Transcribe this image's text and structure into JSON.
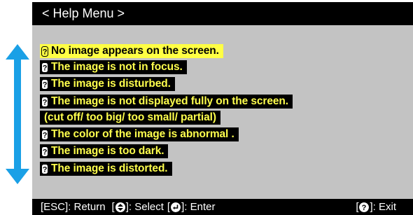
{
  "title": "< Help Menu >",
  "accent_color": "#1aa0e6",
  "items": [
    {
      "label": "No image appears on the screen.",
      "selected": true
    },
    {
      "label": "The image is not in focus.",
      "selected": false
    },
    {
      "label": "The image is disturbed.",
      "selected": false
    },
    {
      "label": "The image is not displayed fully on the screen.",
      "selected": false
    },
    {
      "label": "(cut off/ too big/ too small/ partial)",
      "continuation": true
    },
    {
      "label": "The color of the image is abnormal .",
      "selected": false
    },
    {
      "label": "The image is too dark.",
      "selected": false
    },
    {
      "label": "The image is distorted.",
      "selected": false
    }
  ],
  "footer": {
    "return_text": "[ESC]: Return",
    "select_open": "[",
    "select_text": "]: Select",
    "enter_open": "[",
    "enter_text": "]: Enter",
    "exit_open": "[",
    "exit_text": "]: Exit"
  },
  "icons": {
    "scroll": "up-down-arrow-icon",
    "item": "question-mark-icon",
    "select": "up-down-triangle-icon",
    "enter": "enter-key-icon",
    "exit": "help-icon"
  }
}
